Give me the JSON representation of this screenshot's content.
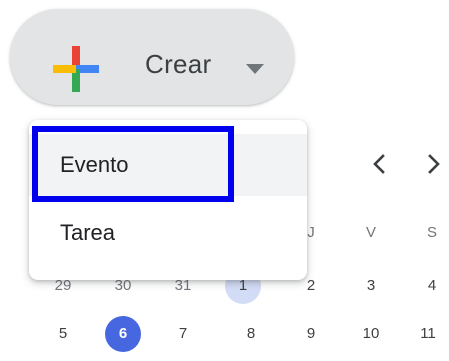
{
  "create_button": {
    "label": "Crear",
    "icon": "google-plus-icon",
    "caret_icon": "caret-down-icon"
  },
  "menu": {
    "items": [
      {
        "label": "Evento",
        "highlighted": true
      },
      {
        "label": "Tarea",
        "highlighted": false
      }
    ]
  },
  "calendar": {
    "nav_prev_icon": "chevron-left-icon",
    "nav_next_icon": "chevron-right-icon",
    "weekday_headers": [
      "J",
      "V",
      "S"
    ],
    "week1": [
      "29",
      "30",
      "31",
      "1",
      "2",
      "3",
      "4"
    ],
    "week2": [
      "5",
      "6",
      "7",
      "8",
      "9",
      "10",
      "11"
    ],
    "highlighted_day": "1",
    "today": "6"
  },
  "colors": {
    "today_bg": "#4767e0",
    "selected_day_bg": "#d3dcf6",
    "button_bg": "#e3e4e6",
    "focus_outline": "#0000ee",
    "plus_blue": "#4285f4",
    "plus_red": "#ea4335",
    "plus_yellow": "#fbbc04",
    "plus_green": "#34a853"
  }
}
